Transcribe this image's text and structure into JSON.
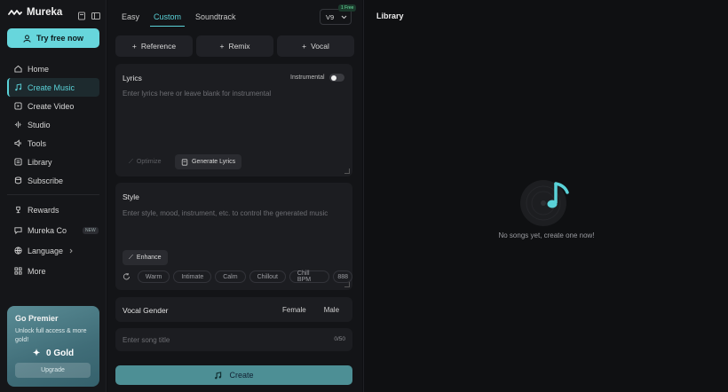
{
  "app": {
    "brand": "Mureka"
  },
  "sidebar": {
    "try_label": "Try free now",
    "items": [
      {
        "label": "Home",
        "icon": "home-icon"
      },
      {
        "label": "Create Music",
        "icon": "music-note-icon",
        "active": true
      },
      {
        "label": "Create Video",
        "icon": "video-icon"
      },
      {
        "label": "Studio",
        "icon": "waveform-icon"
      },
      {
        "label": "Tools",
        "icon": "speaker-icon"
      },
      {
        "label": "Library",
        "icon": "library-icon"
      },
      {
        "label": "Subscribe",
        "icon": "stack-icon"
      }
    ],
    "items2": [
      {
        "label": "Rewards",
        "icon": "trophy-icon"
      },
      {
        "label": "Mureka Co",
        "icon": "chat-icon",
        "badge": "NEW"
      },
      {
        "label": "Language",
        "icon": "globe-icon"
      },
      {
        "label": "More",
        "icon": "grid-icon"
      }
    ],
    "premier": {
      "title": "Go Premier",
      "desc": "Unlock full access & more gold!",
      "gold": "0 Gold",
      "upgrade": "Upgrade"
    }
  },
  "main": {
    "tabs": [
      "Easy",
      "Custom",
      "Soundtrack"
    ],
    "active_tab": "Custom",
    "version": "V9",
    "version_badge": "1 Free",
    "tools": [
      "Reference",
      "Remix",
      "Vocal"
    ],
    "lyrics": {
      "title": "Lyrics",
      "instrumental_label": "Instrumental",
      "placeholder": "Enter lyrics here or leave blank for instrumental",
      "optimize": "Optimize",
      "generate": "Generate Lyrics"
    },
    "style": {
      "title": "Style",
      "placeholder": "Enter style, mood, instrument, etc. to control the generated music",
      "enhance": "Enhance",
      "chips": [
        "Warm",
        "Intimate",
        "Calm",
        "Chillout",
        "Chill BPM",
        "888"
      ]
    },
    "vocal_gender": {
      "title": "Vocal Gender",
      "options": [
        "Female",
        "Male"
      ]
    },
    "song_title": {
      "placeholder": "Enter song title",
      "counter": "0/50"
    },
    "create": "Create"
  },
  "library": {
    "title": "Library",
    "empty": "No songs yet, create one now!"
  },
  "colors": {
    "accent": "#5ad2d8",
    "create_btn": "#4d8f95",
    "premier_bg": "#4a7c86"
  }
}
